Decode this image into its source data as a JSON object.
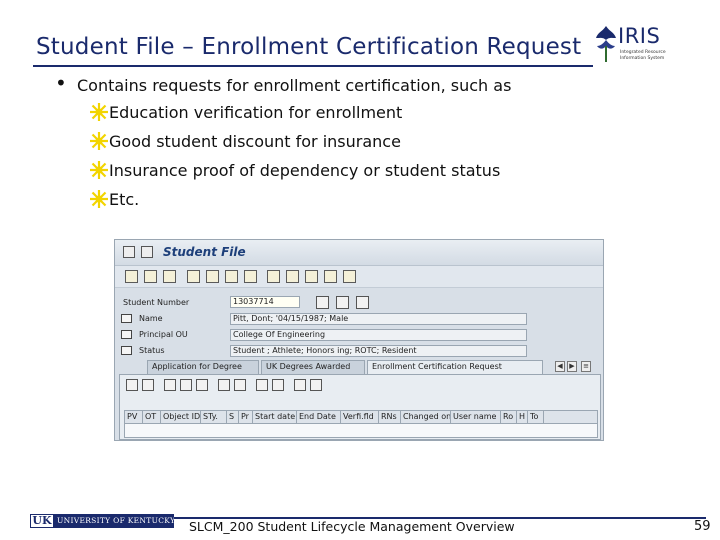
{
  "slide": {
    "title": "Student File – Enrollment Certification Request",
    "logo_word": "IRIS",
    "logo_sub_lines": [
      "Integrated Resource",
      "Information System"
    ],
    "bullet": "Contains requests for enrollment certification, such as",
    "sub_bullets": [
      "Education verification for enrollment",
      "Good student discount for insurance",
      "Insurance proof of dependency or student status",
      "Etc."
    ],
    "footer_logo_uk": "UK",
    "footer_logo_name": "UNIVERSITY OF KENTUCKY",
    "footer_text": "SLCM_200 Student Lifecycle Management Overview",
    "page_number": "59",
    "colors": {
      "title": "#1a2a6c",
      "star": "#f2d400"
    }
  },
  "sap": {
    "window_title": "Student File",
    "student_number_label": "Student Number",
    "student_number_value": "13037714",
    "name_label": "Name",
    "name_value": "Pitt, Dont; '04/15/1987; Male",
    "principal_label": "Principal OU",
    "principal_value": "College Of Engineering",
    "status_label": "Status",
    "status_value": "Student ; Athlete; Honors  ing; ROTC; Resident",
    "tabs": [
      "Application for Degree",
      "UK Degrees Awarded",
      "Enrollment Certification Request"
    ],
    "columns": [
      "PV",
      "OT",
      "Object ID",
      "STy.",
      "S",
      "Pr",
      "Start date",
      "End Date",
      "Verfi.fld",
      "RNs",
      "Changed on",
      "User name",
      "Ro",
      "H",
      "To"
    ]
  }
}
